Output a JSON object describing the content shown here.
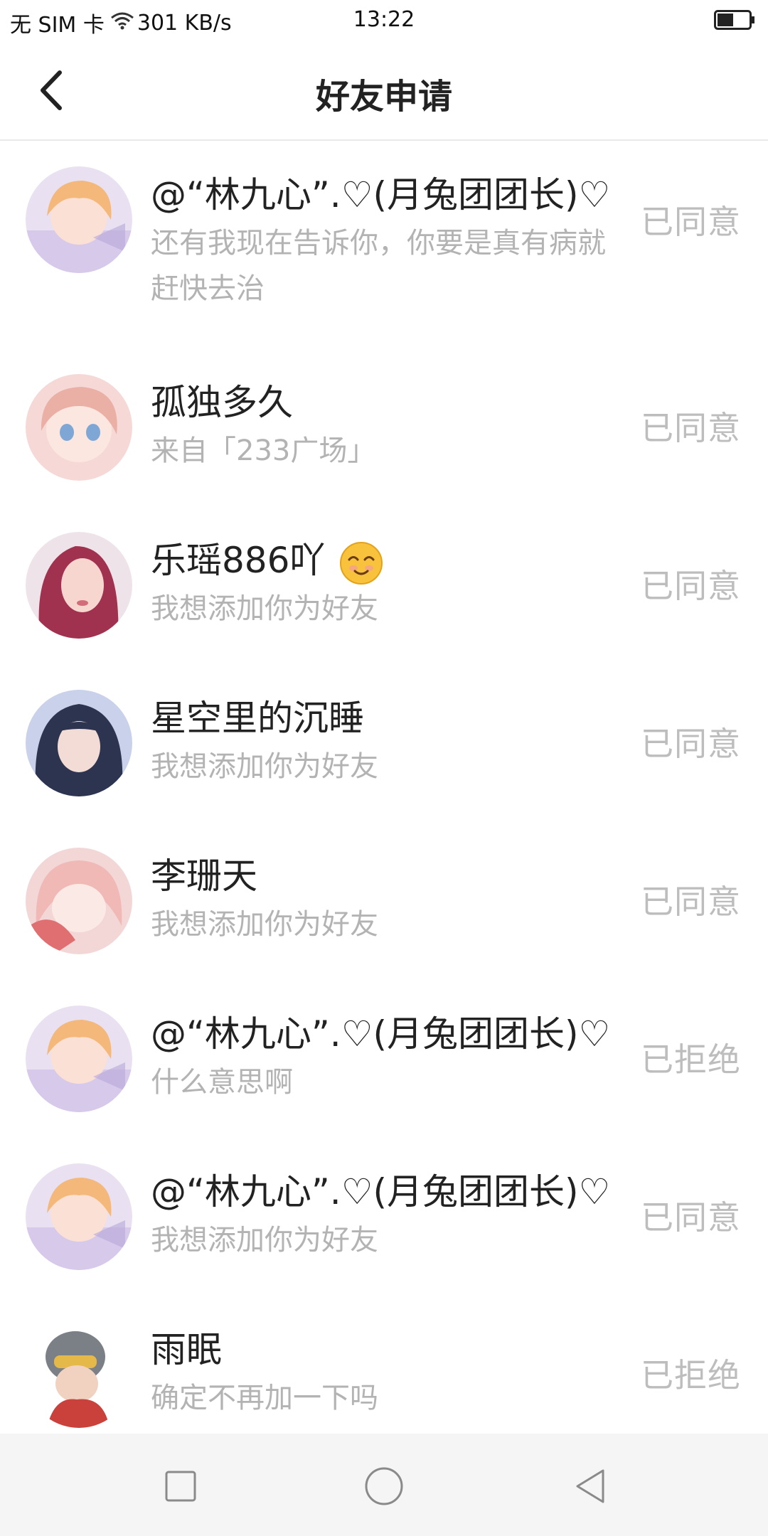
{
  "status_bar": {
    "carrier": "无 SIM 卡",
    "speed": "301 KB/s",
    "time": "13:22"
  },
  "header": {
    "title": "好友申请"
  },
  "requests": [
    {
      "name": "@“林九心”.♡(月兔团团长)♡",
      "message": "还有我现在告诉你，你要是真有病就赶快去治",
      "status": "已同意",
      "avatar": "avatar-blonde"
    },
    {
      "name": "孤独多久",
      "message": "来自「233广场」",
      "status": "已同意",
      "avatar": "avatar-pink-hair"
    },
    {
      "name": "乐瑶886吖",
      "message": "我想添加你为好友",
      "status": "已同意",
      "avatar": "avatar-red-hair",
      "emoji": "smile-emoji"
    },
    {
      "name": "星空里的沉睡",
      "message": "我想添加你为好友",
      "status": "已同意",
      "avatar": "avatar-dark-hair"
    },
    {
      "name": "李珊天",
      "message": "我想添加你为好友",
      "status": "已同意",
      "avatar": "avatar-pink-girl"
    },
    {
      "name": "@“林九心”.♡(月兔团团长)♡",
      "message": "什么意思啊",
      "status": "已拒绝",
      "avatar": "avatar-blonde"
    },
    {
      "name": "@“林九心”.♡(月兔团团长)♡",
      "message": "我想添加你为好友",
      "status": "已同意",
      "avatar": "avatar-blonde"
    },
    {
      "name": "雨眠",
      "message": "确定不再加一下吗",
      "status": "已拒绝",
      "avatar": "avatar-helmet"
    }
  ],
  "nav_bar": {
    "icons": [
      "square-icon",
      "circle-icon",
      "triangle-back-icon"
    ]
  }
}
